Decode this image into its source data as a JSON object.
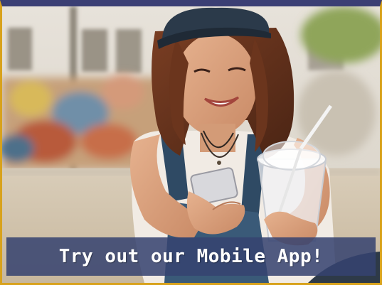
{
  "promo": {
    "banner_text": "Try out our Mobile App!"
  },
  "colors": {
    "top_bar": "#3b3f74",
    "border_accent": "#d8a21c",
    "banner_bg": "#364270"
  },
  "image": {
    "icon": "woman-using-phone-photo"
  }
}
